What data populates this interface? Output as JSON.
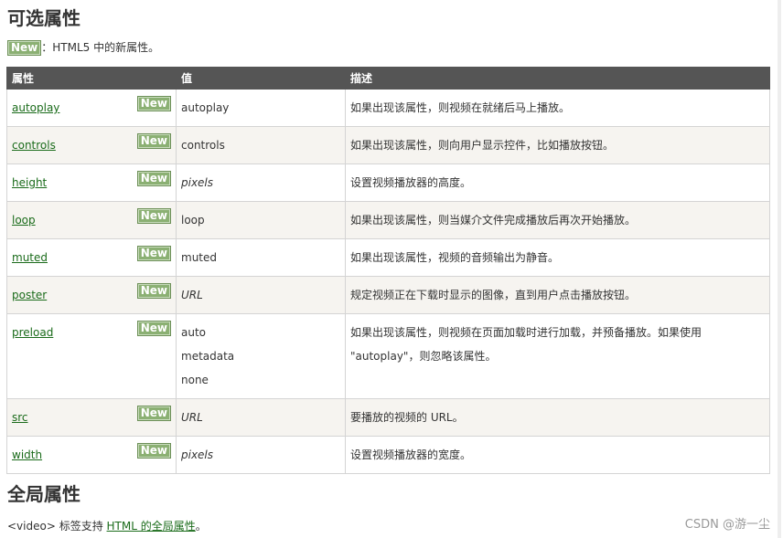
{
  "section1": {
    "title": "可选属性",
    "badge": "New",
    "note_text": "：HTML5 中的新属性。"
  },
  "table": {
    "headers": [
      "属性",
      "值",
      "描述"
    ],
    "rows": [
      {
        "attr": "autoplay",
        "badge": "New",
        "values": [
          "autoplay"
        ],
        "italic": false,
        "desc": "如果出现该属性，则视频在就绪后马上播放。"
      },
      {
        "attr": "controls",
        "badge": "New",
        "values": [
          "controls"
        ],
        "italic": false,
        "desc": "如果出现该属性，则向用户显示控件，比如播放按钮。"
      },
      {
        "attr": "height",
        "badge": "New",
        "values": [
          "pixels"
        ],
        "italic": true,
        "desc": "设置视频播放器的高度。"
      },
      {
        "attr": "loop",
        "badge": "New",
        "values": [
          "loop"
        ],
        "italic": false,
        "desc": "如果出现该属性，则当媒介文件完成播放后再次开始播放。"
      },
      {
        "attr": "muted",
        "badge": "New",
        "values": [
          "muted"
        ],
        "italic": false,
        "desc": "如果出现该属性，视频的音频输出为静音。"
      },
      {
        "attr": "poster",
        "badge": "New",
        "values": [
          "URL"
        ],
        "italic": true,
        "desc": "规定视频正在下载时显示的图像，直到用户点击播放按钮。"
      },
      {
        "attr": "preload",
        "badge": "New",
        "values": [
          "auto",
          "metadata",
          "none"
        ],
        "italic": false,
        "desc": "如果出现该属性，则视频在页面加载时进行加载，并预备播放。如果使用 \"autoplay\"，则忽略该属性。"
      },
      {
        "attr": "src",
        "badge": "New",
        "values": [
          "URL"
        ],
        "italic": true,
        "desc": "要播放的视频的 URL。"
      },
      {
        "attr": "width",
        "badge": "New",
        "values": [
          "pixels"
        ],
        "italic": true,
        "desc": "设置视频播放器的宽度。"
      }
    ]
  },
  "section2": {
    "title": "全局属性",
    "text_before": "<video> 标签支持 ",
    "link": "HTML 的全局属性",
    "text_after": "。"
  },
  "watermark": "CSDN @游一尘"
}
